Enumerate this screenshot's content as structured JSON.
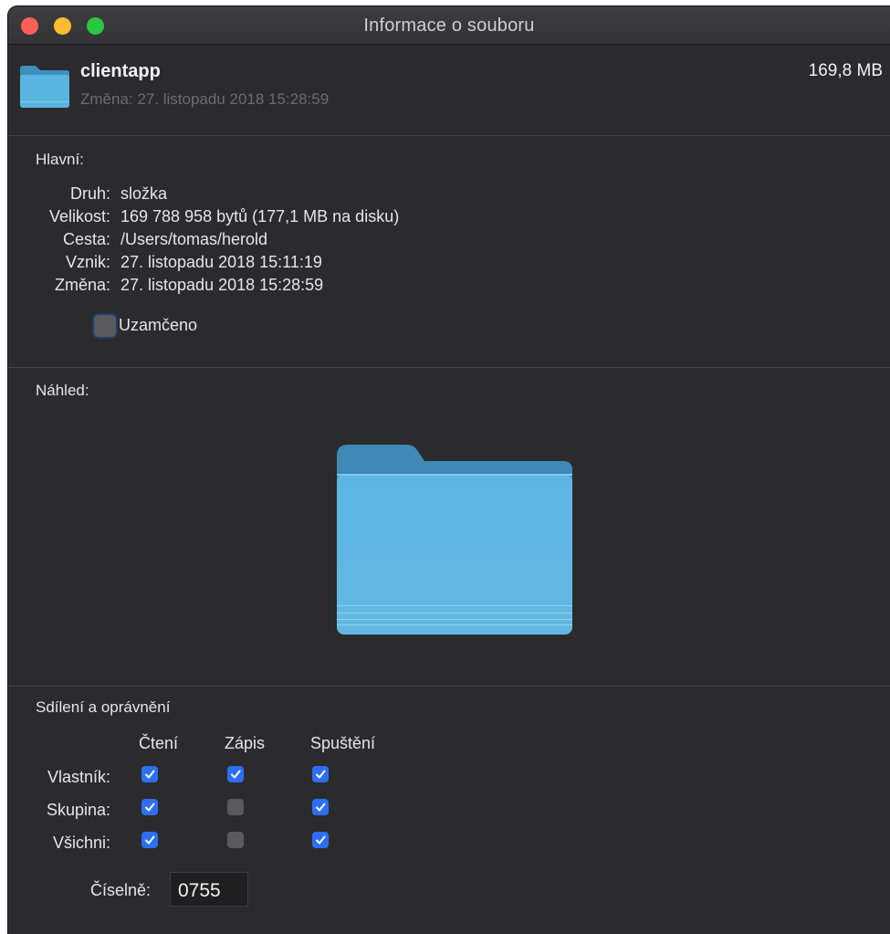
{
  "window": {
    "title": "Informace o souboru"
  },
  "header": {
    "name": "clientapp",
    "modified": "Změna: 27. listopadu 2018 15:28:59",
    "size": "169,8 MB"
  },
  "general": {
    "heading": "Hlavní:",
    "rows": [
      {
        "key": "Druh:",
        "value": "složka"
      },
      {
        "key": "Velikost:",
        "value": "169 788 958 bytů (177,1 MB na disku)"
      },
      {
        "key": "Cesta:",
        "value": "/Users/tomas/herold"
      },
      {
        "key": "Vznik:",
        "value": "27. listopadu 2018 15:11:19"
      },
      {
        "key": "Změna:",
        "value": "27. listopadu 2018 15:28:59"
      }
    ],
    "locked_label": "Uzamčeno",
    "locked": false
  },
  "preview": {
    "heading": "Náhled:"
  },
  "sharing": {
    "heading": "Sdílení a oprávnění",
    "columns": [
      "Čtení",
      "Zápis",
      "Spuštění"
    ],
    "rows": [
      {
        "label": "Vlastník:",
        "read": true,
        "write": true,
        "exec": true
      },
      {
        "label": "Skupina:",
        "read": true,
        "write": false,
        "exec": true
      },
      {
        "label": "Všichni:",
        "read": true,
        "write": false,
        "exec": true
      }
    ],
    "numeric_label": "Číselně:",
    "numeric_value": "0755"
  },
  "colors": {
    "accent": "#2d6ff2",
    "folder": "#5ab4e0",
    "background": "#2b2b2d"
  }
}
